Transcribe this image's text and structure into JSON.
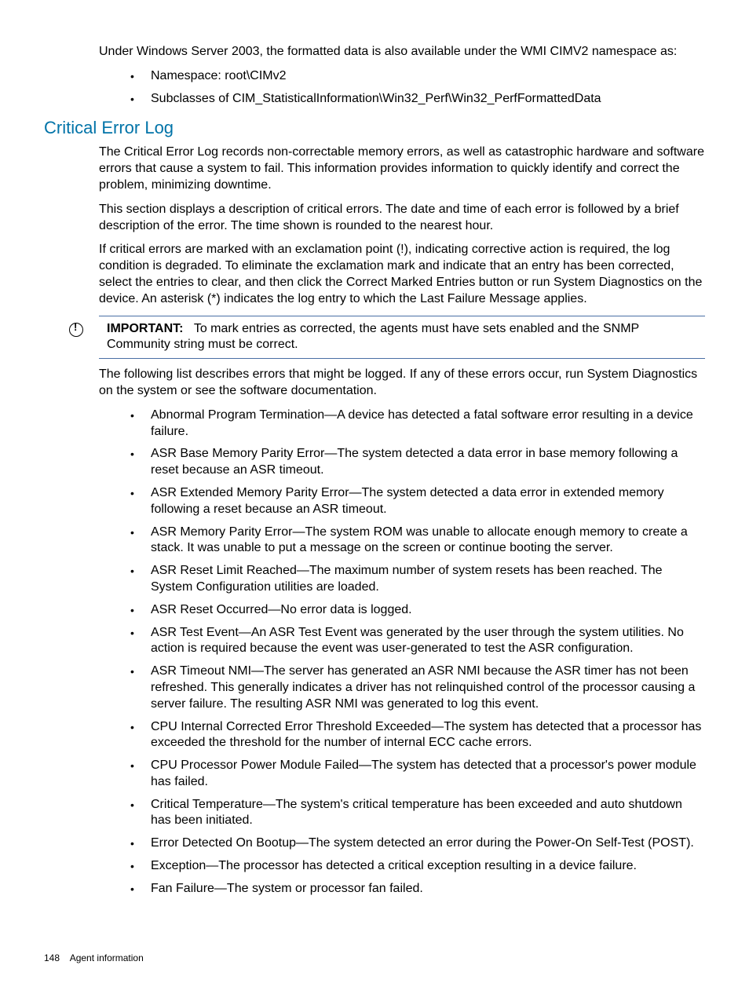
{
  "intro": {
    "para1": "Under Windows Server 2003, the formatted data is also available under the WMI CIMV2 namespace as:",
    "bullets": [
      "Namespace: root\\CIMv2",
      "Subclasses of CIM_StatisticalInformation\\Win32_Perf\\Win32_PerfFormattedData"
    ]
  },
  "section": {
    "heading": "Critical Error Log",
    "para1": "The Critical Error Log records non-correctable memory errors, as well as catastrophic hardware and software errors that cause a system to fail. This information provides information to quickly identify and correct the problem, minimizing downtime.",
    "para2": "This section displays a description of critical errors. The date and time of each error is followed by a brief description of the error. The time shown is rounded to the nearest hour.",
    "para3": "If critical errors are marked with an exclamation point (!), indicating corrective action is required, the log condition is degraded. To eliminate the exclamation mark and indicate that an entry has been corrected, select the entries to clear, and then click the Correct Marked Entries button or run System Diagnostics on the device. An asterisk (*) indicates the log entry to which the Last Failure Message applies."
  },
  "callout": {
    "label": "IMPORTANT:",
    "text": "To mark entries as corrected, the agents must have sets enabled and the SNMP Community string must be correct."
  },
  "after_callout": {
    "para": "The following list describes errors that might be logged. If any of these errors occur, run System Diagnostics on the system or see the software documentation."
  },
  "errors": [
    "Abnormal Program Termination—A device has detected a fatal software error resulting in a device failure.",
    "ASR Base Memory Parity Error—The system detected a data error in base memory following a reset because an ASR timeout.",
    "ASR Extended Memory Parity Error—The system detected a data error in extended memory following a reset because an ASR timeout.",
    "ASR Memory Parity Error—The system ROM was unable to allocate enough memory to create a stack. It was unable to put a message on the screen or continue booting the server.",
    "ASR Reset Limit Reached—The maximum number of system resets has been reached. The System Configuration utilities are loaded.",
    "ASR Reset Occurred—No error data is logged.",
    "ASR Test Event—An ASR Test Event was generated by the user through the system utilities. No action is required because the event was user-generated to test the ASR configuration.",
    "ASR Timeout NMI—The server has generated an ASR NMI because the ASR timer has not been refreshed. This generally indicates a driver has not relinquished control of the processor causing a server failure. The resulting ASR NMI was generated to log this event.",
    "CPU Internal Corrected Error Threshold Exceeded—The system has detected that a processor has exceeded the threshold for the number of internal ECC cache errors.",
    "CPU Processor Power Module Failed—The system has detected that a processor's power module has failed.",
    "Critical Temperature—The system's critical temperature has been exceeded and auto shutdown has been initiated.",
    "Error Detected On Bootup—The system detected an error during the Power-On Self-Test (POST).",
    "Exception—The processor has detected a critical exception resulting in a device failure.",
    "Fan Failure—The system or processor fan failed."
  ],
  "footer": {
    "page": "148",
    "title": "Agent information"
  }
}
